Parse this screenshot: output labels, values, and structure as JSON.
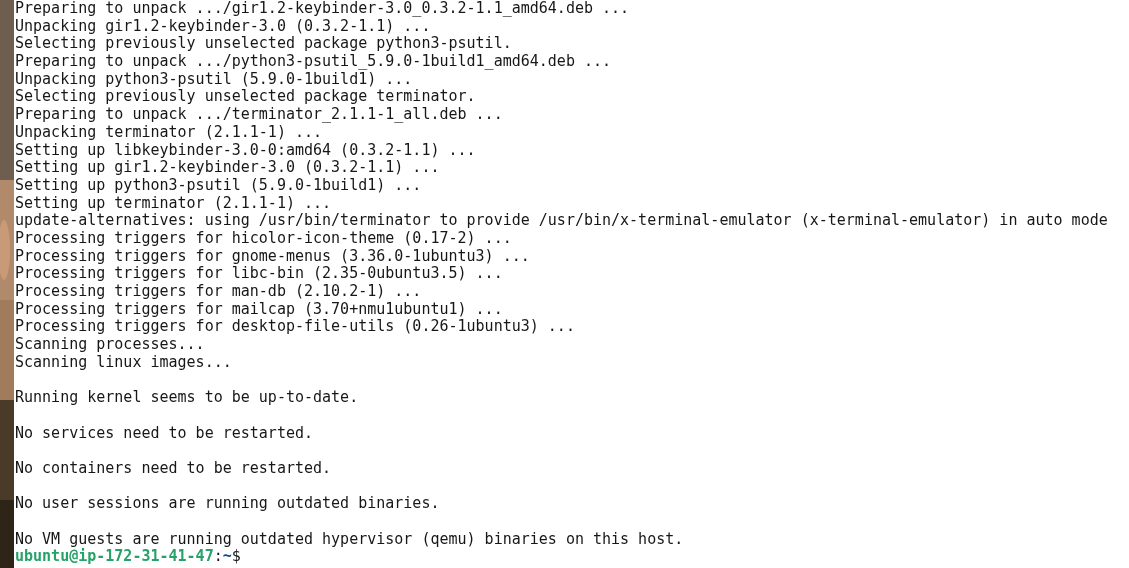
{
  "terminal": {
    "lines": [
      {
        "kind": "text",
        "text": "Preparing to unpack .../gir1.2-keybinder-3.0_0.3.2-1.1_amd64.deb ..."
      },
      {
        "kind": "text",
        "text": "Unpacking gir1.2-keybinder-3.0 (0.3.2-1.1) ..."
      },
      {
        "kind": "text",
        "text": "Selecting previously unselected package python3-psutil."
      },
      {
        "kind": "text",
        "text": "Preparing to unpack .../python3-psutil_5.9.0-1build1_amd64.deb ..."
      },
      {
        "kind": "text",
        "text": "Unpacking python3-psutil (5.9.0-1build1) ..."
      },
      {
        "kind": "text",
        "text": "Selecting previously unselected package terminator."
      },
      {
        "kind": "text",
        "text": "Preparing to unpack .../terminator_2.1.1-1_all.deb ..."
      },
      {
        "kind": "text",
        "text": "Unpacking terminator (2.1.1-1) ..."
      },
      {
        "kind": "text",
        "text": "Setting up libkeybinder-3.0-0:amd64 (0.3.2-1.1) ..."
      },
      {
        "kind": "text",
        "text": "Setting up gir1.2-keybinder-3.0 (0.3.2-1.1) ..."
      },
      {
        "kind": "text",
        "text": "Setting up python3-psutil (5.9.0-1build1) ..."
      },
      {
        "kind": "text",
        "text": "Setting up terminator (2.1.1-1) ..."
      },
      {
        "kind": "text",
        "text": "update-alternatives: using /usr/bin/terminator to provide /usr/bin/x-terminal-emulator (x-terminal-emulator) in auto mode"
      },
      {
        "kind": "text",
        "text": "Processing triggers for hicolor-icon-theme (0.17-2) ..."
      },
      {
        "kind": "text",
        "text": "Processing triggers for gnome-menus (3.36.0-1ubuntu3) ..."
      },
      {
        "kind": "text",
        "text": "Processing triggers for libc-bin (2.35-0ubuntu3.5) ..."
      },
      {
        "kind": "text",
        "text": "Processing triggers for man-db (2.10.2-1) ..."
      },
      {
        "kind": "text",
        "text": "Processing triggers for mailcap (3.70+nmu1ubuntu1) ..."
      },
      {
        "kind": "text",
        "text": "Processing triggers for desktop-file-utils (0.26-1ubuntu3) ..."
      },
      {
        "kind": "text",
        "text": "Scanning processes..."
      },
      {
        "kind": "text",
        "text": "Scanning linux images..."
      },
      {
        "kind": "blank"
      },
      {
        "kind": "text",
        "text": "Running kernel seems to be up-to-date."
      },
      {
        "kind": "blank"
      },
      {
        "kind": "text",
        "text": "No services need to be restarted."
      },
      {
        "kind": "blank"
      },
      {
        "kind": "text",
        "text": "No containers need to be restarted."
      },
      {
        "kind": "blank"
      },
      {
        "kind": "text",
        "text": "No user sessions are running outdated binaries."
      },
      {
        "kind": "blank"
      },
      {
        "kind": "text",
        "text": "No VM guests are running outdated hypervisor (qemu) binaries on this host."
      }
    ],
    "prompt": {
      "user_host": "ubuntu@ip-172-31-41-47",
      "separator": ":",
      "path": "~",
      "symbol": "$"
    }
  }
}
